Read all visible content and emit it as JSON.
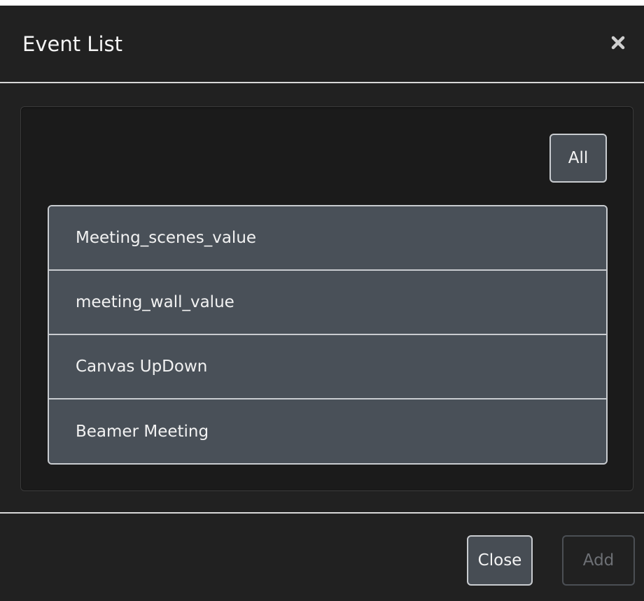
{
  "dialog": {
    "title": "Event List",
    "close_icon": "close-icon"
  },
  "filter": {
    "all_label": "All"
  },
  "events": [
    {
      "label": "Meeting_scenes_value"
    },
    {
      "label": "meeting_wall_value"
    },
    {
      "label": "Canvas UpDown"
    },
    {
      "label": "Beamer Meeting"
    }
  ],
  "footer": {
    "close_label": "Close",
    "add_label": "Add",
    "add_enabled": false
  },
  "colors": {
    "background": "#212121",
    "panel": "#1b1b1b",
    "list_item": "#495058",
    "border": "#c9ccd0",
    "disabled_text": "#6d7075"
  }
}
